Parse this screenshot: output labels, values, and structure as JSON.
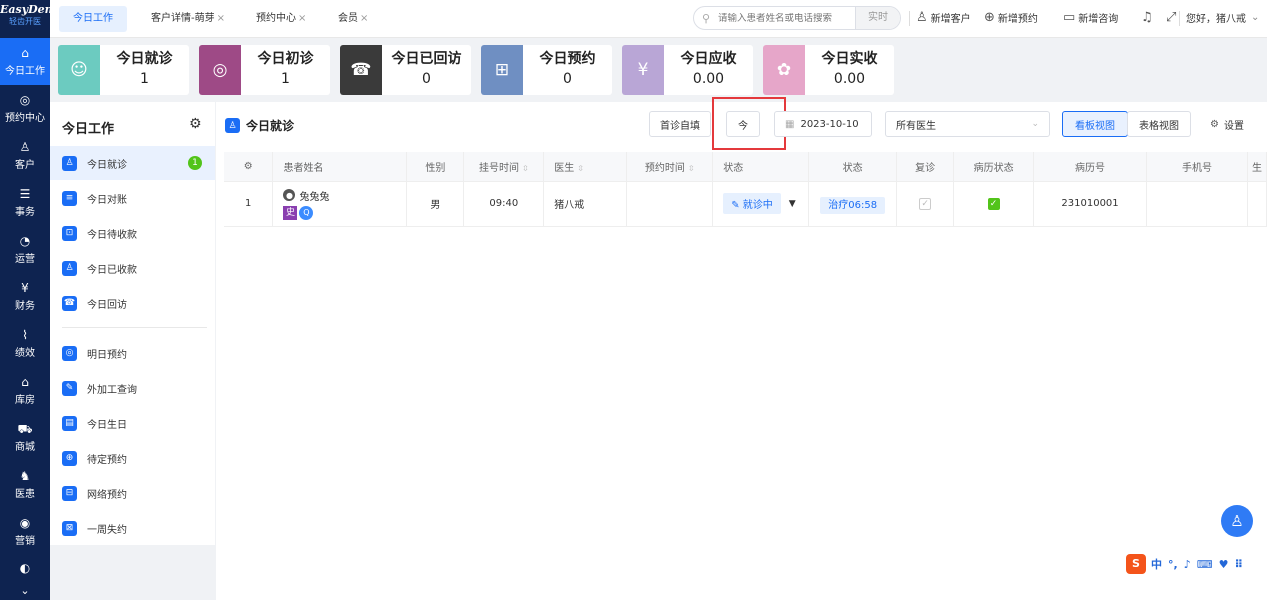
{
  "app": {
    "logo_main": "EasyDent",
    "logo_sub": "轻齿开医"
  },
  "rail": {
    "items": [
      {
        "icon": "home-icon",
        "glyph": "⌂",
        "label": "今日工作"
      },
      {
        "icon": "appointment-icon",
        "glyph": "◎",
        "label": "预约中心"
      },
      {
        "icon": "customer-icon",
        "glyph": "♙",
        "label": "客户"
      },
      {
        "icon": "tasks-icon",
        "glyph": "☰",
        "label": "事务"
      },
      {
        "icon": "operations-icon",
        "glyph": "◔",
        "label": "运营"
      },
      {
        "icon": "finance-icon",
        "glyph": "¥",
        "label": "财务"
      },
      {
        "icon": "performance-icon",
        "glyph": "⌇",
        "label": "绩效"
      },
      {
        "icon": "warehouse-icon",
        "glyph": "⌂",
        "label": "库房"
      },
      {
        "icon": "mall-icon",
        "glyph": "⛟",
        "label": "商城"
      },
      {
        "icon": "doctor-patient-icon",
        "glyph": "♞",
        "label": "医患"
      },
      {
        "icon": "marketing-icon",
        "glyph": "◉",
        "label": "营销"
      },
      {
        "icon": "more-icon",
        "glyph": "◐",
        "label": ""
      }
    ],
    "more": "⌄"
  },
  "header": {
    "tabs": [
      {
        "label": "今日工作"
      },
      {
        "label": "客户详情-萌芽"
      },
      {
        "label": "预约中心"
      },
      {
        "label": "会员"
      }
    ],
    "close": "×",
    "search_placeholder": "请输入患者姓名或电话搜索",
    "realtime": "实时",
    "new_customer": "新增客户",
    "new_appointment": "新增预约",
    "new_consult": "新增咨询",
    "greeting": "您好，猪八戒"
  },
  "cards": [
    {
      "title": "今日就诊",
      "value": "1",
      "color": "#6ccbc0",
      "glyph": "☺"
    },
    {
      "title": "今日初诊",
      "value": "1",
      "color": "#9e4a86",
      "glyph": "◎"
    },
    {
      "title": "今日已回访",
      "value": "0",
      "color": "#3a3a3a",
      "glyph": "☎"
    },
    {
      "title": "今日预约",
      "value": "0",
      "color": "#6f8fc2",
      "glyph": "⊞"
    },
    {
      "title": "今日应收",
      "value": "0.00",
      "color": "#b9a6d6",
      "glyph": "¥"
    },
    {
      "title": "今日实收",
      "value": "0.00",
      "color": "#e6a6c9",
      "glyph": "✿"
    }
  ],
  "side": {
    "title": "今日工作",
    "items": [
      {
        "label": "今日就诊",
        "glyph": "♙",
        "badge": "1"
      },
      {
        "label": "今日对账",
        "glyph": "≡"
      },
      {
        "label": "今日待收款",
        "glyph": "⊡"
      },
      {
        "label": "今日已收款",
        "glyph": "♙"
      },
      {
        "label": "今日回访",
        "glyph": "☎"
      },
      {
        "label": "明日预约",
        "glyph": "◎"
      },
      {
        "label": "外加工查询",
        "glyph": "✎"
      },
      {
        "label": "今日生日",
        "glyph": "▤"
      },
      {
        "label": "待定预约",
        "glyph": "⊕"
      },
      {
        "label": "网络预约",
        "glyph": "⊟"
      },
      {
        "label": "一周失约",
        "glyph": "⊠"
      }
    ]
  },
  "main": {
    "title": "今日就诊",
    "first_visit_fill": "首诊自填",
    "today": "今",
    "date": "2023-10-10",
    "doctor_select": "所有医生",
    "kanban_view": "看板视图",
    "table_view": "表格视图",
    "settings": "设置",
    "columns": [
      "",
      "患者姓名",
      "性别",
      "挂号时间",
      "医生",
      "预约时间",
      "状态",
      "状态",
      "复诊",
      "病历状态",
      "病历号",
      "手机号",
      "生"
    ],
    "rows": [
      {
        "index": "1",
        "name": "兔兔兔",
        "tag_history": "史",
        "tag_q": "Q",
        "gender": "男",
        "reg_time": "09:40",
        "doctor": "猪八戒",
        "appt_time": "",
        "status": "就诊中",
        "treatment": "治疗06:58",
        "revisit": false,
        "record_done": true,
        "record_no": "231010001",
        "phone": ""
      }
    ]
  },
  "ime": {
    "logo": "S",
    "items": [
      "中",
      "°,",
      "♪",
      "⌨",
      "♥",
      "⠿"
    ]
  }
}
